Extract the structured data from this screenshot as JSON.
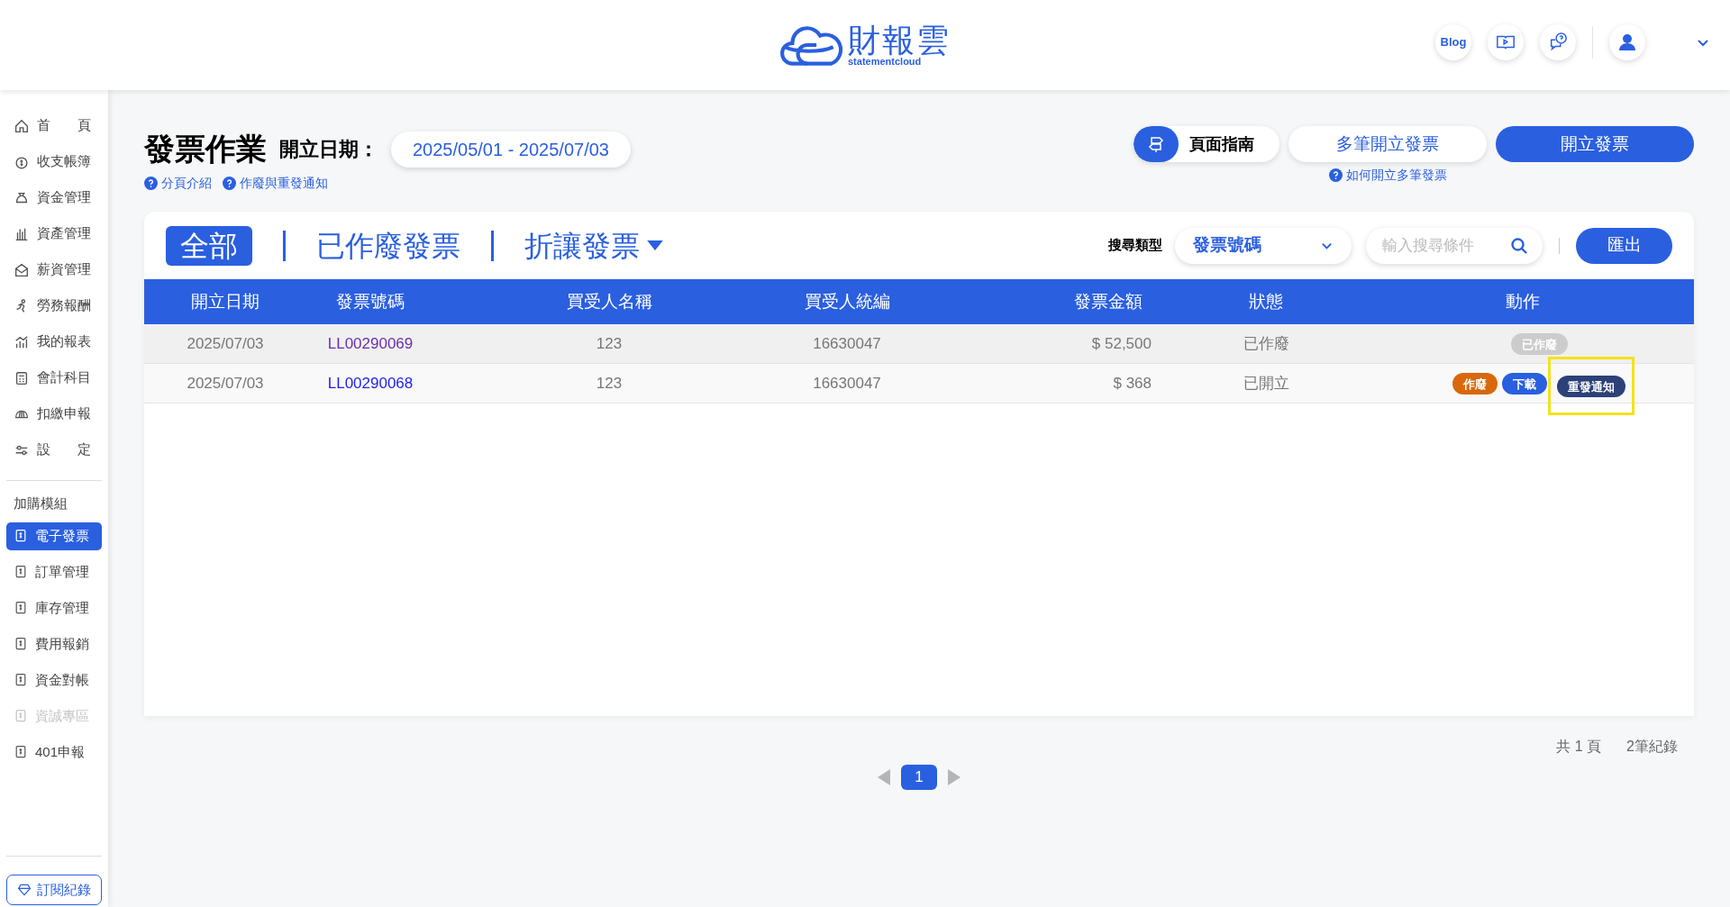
{
  "header": {
    "logo_text": "財報雲",
    "logo_subtext": "statementcloud",
    "blog_label": "Blog"
  },
  "sidebar": {
    "items": [
      {
        "label": "首　　頁",
        "selected": false,
        "disabled": false
      },
      {
        "label": "收支帳簿",
        "selected": false,
        "disabled": false
      },
      {
        "label": "資金管理",
        "selected": false,
        "disabled": false
      },
      {
        "label": "資產管理",
        "selected": false,
        "disabled": false
      },
      {
        "label": "薪資管理",
        "selected": false,
        "disabled": false
      },
      {
        "label": "勞務報酬",
        "selected": false,
        "disabled": false
      },
      {
        "label": "我的報表",
        "selected": false,
        "disabled": false
      },
      {
        "label": "會計科目",
        "selected": false,
        "disabled": false
      },
      {
        "label": "扣繳申報",
        "selected": false,
        "disabled": false
      },
      {
        "label": "設　　定",
        "selected": false,
        "disabled": false
      }
    ],
    "section_title": "加購模組",
    "module_items": [
      {
        "label": "電子發票",
        "selected": true,
        "disabled": false
      },
      {
        "label": "訂單管理",
        "selected": false,
        "disabled": false
      },
      {
        "label": "庫存管理",
        "selected": false,
        "disabled": false
      },
      {
        "label": "費用報銷",
        "selected": false,
        "disabled": false
      },
      {
        "label": "資金對帳",
        "selected": false,
        "disabled": false
      },
      {
        "label": "資誠專區",
        "selected": false,
        "disabled": true
      },
      {
        "label": "401申報",
        "selected": false,
        "disabled": false
      }
    ],
    "subscription_button": "訂閱紀錄"
  },
  "page": {
    "title": "發票作業",
    "date_label": "開立日期：",
    "date_range": "2025/05/01 - 2025/07/03",
    "help_links": [
      "分頁介紹",
      "作廢與重發通知"
    ],
    "guide_button": "頁面指南",
    "batch_button": "多筆開立發票",
    "batch_help": "如何開立多筆發票",
    "issue_button": "開立發票"
  },
  "tabs": [
    {
      "label": "全部",
      "selected": true,
      "dropdown": false
    },
    {
      "label": "已作廢發票",
      "selected": false,
      "dropdown": false
    },
    {
      "label": "折讓發票",
      "selected": false,
      "dropdown": true
    }
  ],
  "search": {
    "type_label": "搜尋類型",
    "type_value": "發票號碼",
    "placeholder": "輸入搜尋條件",
    "export_button": "匯出"
  },
  "table": {
    "columns": [
      "開立日期",
      "發票號碼",
      "買受人名稱",
      "買受人統編",
      "發票金額",
      "狀態",
      "動作"
    ],
    "rows": [
      {
        "date": "2025/07/03",
        "invoice_no": "LL00290069",
        "visited": true,
        "buyer_name": "123",
        "buyer_id": "16630047",
        "amount": "$ 52,500",
        "status": "已作廢",
        "voided": true,
        "actions": [
          {
            "label": "已作廢",
            "color": "#cccccc",
            "highlighted": false
          }
        ]
      },
      {
        "date": "2025/07/03",
        "invoice_no": "LL00290068",
        "visited": false,
        "buyer_name": "123",
        "buyer_id": "16630047",
        "amount": "$ 368",
        "status": "已開立",
        "voided": false,
        "actions": [
          {
            "label": "作廢",
            "color": "#d9680c",
            "highlighted": false
          },
          {
            "label": "下載",
            "color": "#2a5fe0",
            "highlighted": false
          },
          {
            "label": "重發通知",
            "color": "#2c4178",
            "highlighted": true
          }
        ]
      }
    ]
  },
  "pagination": {
    "pages_text": "共 1 頁",
    "records_text": "2筆紀錄",
    "pages": [
      {
        "label": "1",
        "selected": true
      }
    ]
  }
}
